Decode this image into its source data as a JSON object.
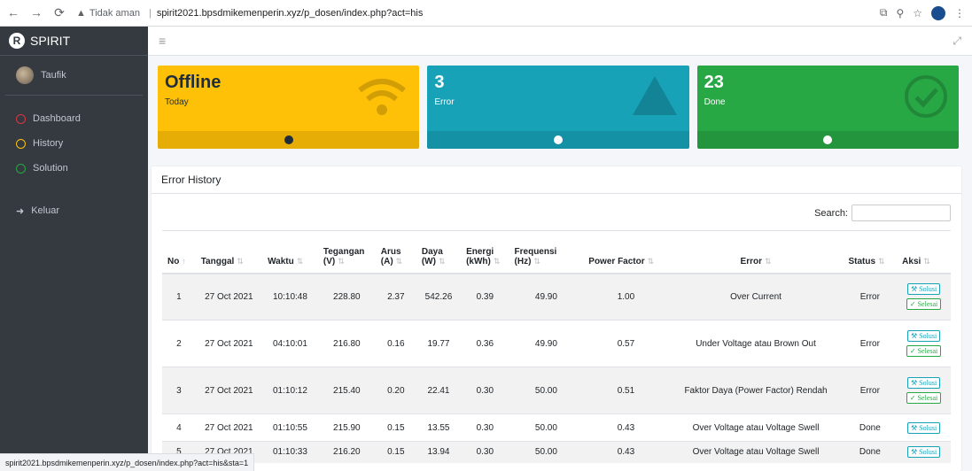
{
  "browser": {
    "security": "Tidak aman",
    "url": "spirit2021.bpsdmikemenperin.xyz/p_dosen/index.php?act=his",
    "status_url": "spirit2021.bpsdmikemenperin.xyz/p_dosen/index.php?act=his&sta=1"
  },
  "sidebar": {
    "brand": "SPIRIT",
    "user": "Taufik",
    "items": [
      {
        "label": "Dashboard",
        "color": "#dc3545"
      },
      {
        "label": "History",
        "color": "#ffc107"
      },
      {
        "label": "Solution",
        "color": "#28a745"
      }
    ],
    "logout": "Keluar"
  },
  "boxes": [
    {
      "value": "Offline",
      "label": "Today",
      "color": "#ffc107",
      "icon": "wifi-icon"
    },
    {
      "value": "3",
      "label": "Error",
      "color": "#17a2b8",
      "icon": "warning-icon"
    },
    {
      "value": "23",
      "label": "Done",
      "color": "#28a745",
      "icon": "check-circle-icon"
    }
  ],
  "card": {
    "title": "Error History",
    "search_label": "Search:"
  },
  "table": {
    "headers": [
      "No",
      "Tanggal",
      "Waktu",
      "Tegangan (V)",
      "Arus (A)",
      "Daya (W)",
      "Energi (kWh)",
      "Frequensi (Hz)",
      "Power Factor",
      "Error",
      "Status",
      "Aksi"
    ],
    "rows": [
      {
        "no": "1",
        "tanggal": "27 Oct 2021",
        "waktu": "10:10:48",
        "tegangan": "228.80",
        "arus": "2.37",
        "daya": "542.26",
        "energi": "0.39",
        "frek": "49.90",
        "pf": "1.00",
        "error": "Over Current",
        "status": "Error"
      },
      {
        "no": "2",
        "tanggal": "27 Oct 2021",
        "waktu": "04:10:01",
        "tegangan": "216.80",
        "arus": "0.16",
        "daya": "19.77",
        "energi": "0.36",
        "frek": "49.90",
        "pf": "0.57",
        "error": "Under Voltage atau Brown Out",
        "status": "Error"
      },
      {
        "no": "3",
        "tanggal": "27 Oct 2021",
        "waktu": "01:10:12",
        "tegangan": "215.40",
        "arus": "0.20",
        "daya": "22.41",
        "energi": "0.30",
        "frek": "50.00",
        "pf": "0.51",
        "error": "Faktor Daya (Power Factor) Rendah",
        "status": "Error"
      },
      {
        "no": "4",
        "tanggal": "27 Oct 2021",
        "waktu": "01:10:55",
        "tegangan": "215.90",
        "arus": "0.15",
        "daya": "13.55",
        "energi": "0.30",
        "frek": "50.00",
        "pf": "0.43",
        "error": "Over Voltage atau Voltage Swell",
        "status": "Done"
      },
      {
        "no": "5",
        "tanggal": "27 Oct 2021",
        "waktu": "01:10:33",
        "tegangan": "216.20",
        "arus": "0.15",
        "daya": "13.94",
        "energi": "0.30",
        "frek": "50.00",
        "pf": "0.43",
        "error": "Over Voltage atau Voltage Swell",
        "status": "Done"
      }
    ],
    "btn_solusi": "Solusi",
    "btn_selesai": "Selesai"
  }
}
